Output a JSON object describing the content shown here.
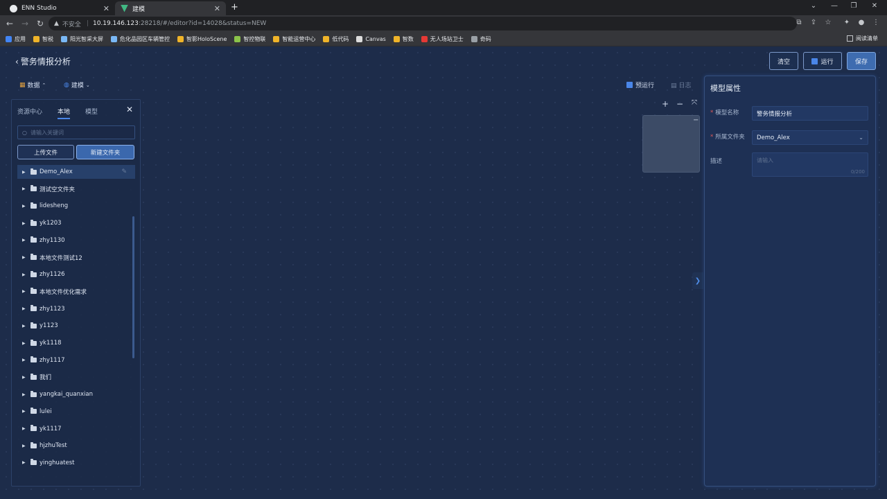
{
  "browser": {
    "tabs": [
      {
        "label": "ENN Studio",
        "icon": "globe-icon"
      },
      {
        "label": "建模",
        "icon": "vue-logo-icon"
      }
    ],
    "url": {
      "security": "不安全",
      "host": "10.19.146.123",
      "rest": ":28218/#/editor?id=14028&status=NEW"
    },
    "bookmarks": [
      {
        "label": "应用",
        "color": "#4285f4"
      },
      {
        "label": "智税",
        "color": "#f0b429"
      },
      {
        "label": "阳光智采大屏",
        "color": "#7ab8f5"
      },
      {
        "label": "危化品园区车辆管控",
        "color": "#7ab8f5"
      },
      {
        "label": "智影HoloScene",
        "color": "#f0b429"
      },
      {
        "label": "智控物联",
        "color": "#8bc34a"
      },
      {
        "label": "智能运营中心",
        "color": "#f0b429"
      },
      {
        "label": "低代码",
        "color": "#f0b429"
      },
      {
        "label": "Canvas",
        "color": "#dddddd"
      },
      {
        "label": "智数",
        "color": "#f0b429"
      },
      {
        "label": "无人场站卫士",
        "color": "#e53935"
      },
      {
        "label": "奇码",
        "color": "#9aa0a6"
      }
    ],
    "reading_list": "阅读清单"
  },
  "app": {
    "page_title": "警务情报分析",
    "top_buttons": {
      "clear": "清空",
      "run": "运行",
      "save": "保存"
    },
    "toolbar": {
      "data": "数据",
      "model": "建模"
    },
    "left_panel": {
      "tabs": [
        "资源中心",
        "本地",
        "模型"
      ],
      "search_placeholder": "请输入关键词",
      "upload_label": "上传文件",
      "new_folder_label": "新建文件夹",
      "tree": [
        "Demo_Alex",
        "测试空文件夹",
        "lidesheng",
        "yk1203",
        "zhy1130",
        "本地文件测试12",
        "zhy1126",
        "本地文件优化需求",
        "zhy1123",
        "y1123",
        "yk1118",
        "zhy1117",
        "我们",
        "yangkai_quanxian",
        "lulei",
        "yk1117",
        "hjzhuTest",
        "yinghuatest"
      ]
    },
    "canvas": {
      "prerun": "预运行",
      "log": "日志"
    },
    "right_panel": {
      "title": "模型属性",
      "name_label": "模型名称",
      "name_value": "警务情报分析",
      "folder_label": "所属文件夹",
      "folder_value": "Demo_Alex",
      "desc_label": "描述",
      "desc_placeholder": "请输入",
      "desc_count": "0/200"
    }
  },
  "colors": {
    "accent": "#4a86e8",
    "background": "#1d2c4a",
    "required": "#e05a5a"
  }
}
